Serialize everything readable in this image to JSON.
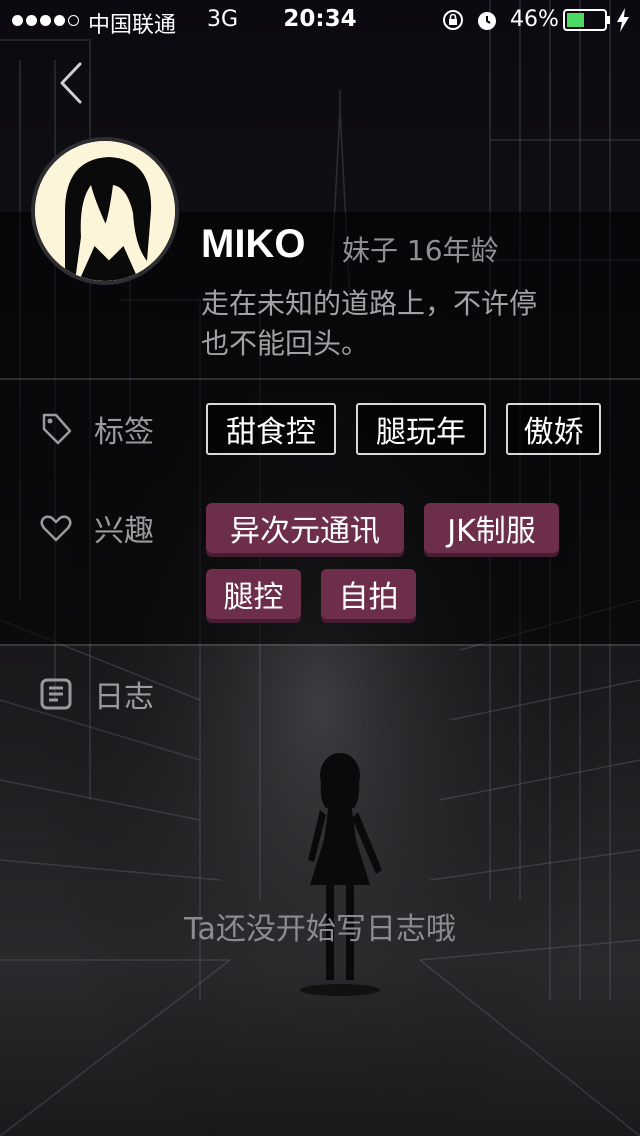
{
  "status_bar": {
    "carrier": "中国联通",
    "network": "3G",
    "time": "20:34",
    "battery": "46%",
    "battery_level": 0.46,
    "signal_bars": 4
  },
  "profile": {
    "name": "MIKO",
    "meta": "妹子 16年龄",
    "bio_line1": "走在未知的道路上，不许停",
    "bio_line2": "也不能回头。"
  },
  "sections": {
    "tags_label": "标签",
    "interests_label": "兴趣",
    "diary_label": "日志"
  },
  "tags": [
    "甜食控",
    "腿玩年",
    "傲娇"
  ],
  "interests": [
    "异次元通讯",
    "JK制服",
    "腿控",
    "自拍"
  ],
  "diary": {
    "empty_text": "Ta还没开始写日志哦"
  },
  "colors": {
    "interest_tag_bg": "#6d2e4c",
    "label_gray": "#9a9a9e",
    "battery_green": "#4cd964"
  },
  "icons": {
    "back": "chevron-left-icon",
    "tags": "tag-icon",
    "interests": "heart-icon",
    "diary": "document-icon"
  }
}
